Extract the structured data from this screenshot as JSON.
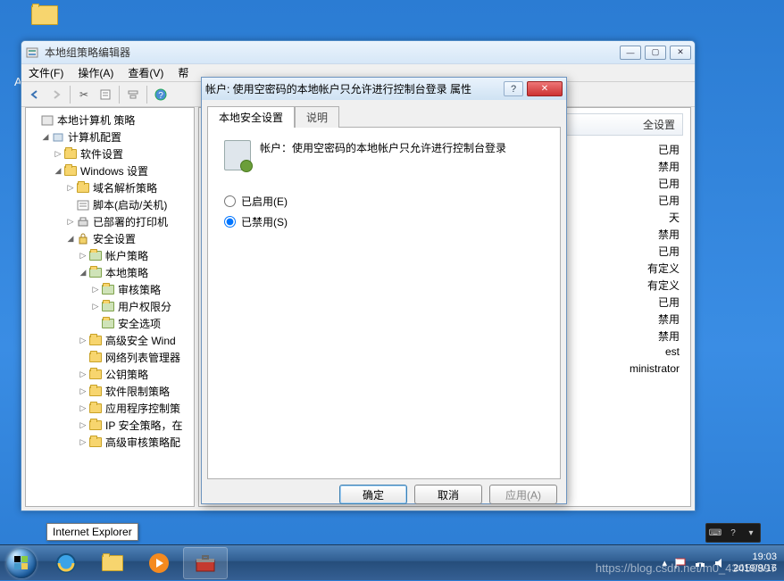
{
  "desktop": {
    "a_label": "A"
  },
  "mmc": {
    "title": "本地组策略编辑器",
    "menu": {
      "file": "文件(F)",
      "action": "操作(A)",
      "view": "查看(V)",
      "help": "帮"
    },
    "tree": {
      "root": "本地计算机 策略",
      "computer_cfg": "计算机配置",
      "software": "软件设置",
      "windows_settings": "Windows 设置",
      "dns_policy": "域名解析策略",
      "scripts": "脚本(启动/关机)",
      "deployed_printers": "已部署的打印机",
      "security_settings": "安全设置",
      "account_policy": "帐户策略",
      "local_policy": "本地策略",
      "audit_policy": "审核策略",
      "user_rights": "用户权限分",
      "security_options": "安全选项",
      "adv_security_win": "高级安全 Wind",
      "nlm": "网络列表管理器",
      "pubkey": "公钥策略",
      "srp": "软件限制策略",
      "appctrl": "应用程序控制策",
      "ipsec": "IP 安全策略，在",
      "adv_audit": "高级审核策略配"
    },
    "list_header": "全设置",
    "right_values": [
      "已用",
      "禁用",
      "已用",
      "已用",
      "天",
      "禁用",
      "已用",
      "有定义",
      "有定义",
      "已用",
      "禁用",
      "禁用",
      "est",
      "ministrator"
    ]
  },
  "dialog": {
    "title": "帐户: 使用空密码的本地帐户只允许进行控制台登录 属性",
    "tab_security": "本地安全设置",
    "tab_explain": "说明",
    "policy_text": "帐户：使用空密码的本地帐户只允许进行控制台登录",
    "opt_enabled": "已启用(E)",
    "opt_disabled": "已禁用(S)",
    "selected": "disabled",
    "btn_ok": "确定",
    "btn_cancel": "取消",
    "btn_apply": "应用(A)"
  },
  "taskbar": {
    "tooltip_ie": "Internet Explorer",
    "time": "19:03",
    "date": "2019/9/16"
  },
  "watermark": "https://blog.csdn.net/m0_43450897"
}
